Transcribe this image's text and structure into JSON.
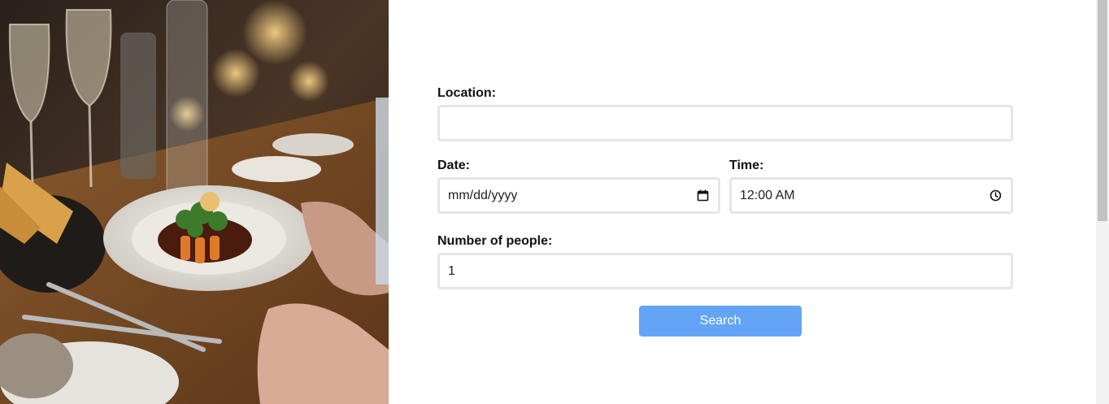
{
  "hero_image": {
    "description_icon": "restaurant-photo"
  },
  "form": {
    "location": {
      "label": "Location:",
      "value": ""
    },
    "date": {
      "label": "Date:",
      "value": "mm/dd/yyyy",
      "icon": "calendar-icon"
    },
    "time": {
      "label": "Time:",
      "value": "12:00 AM",
      "icon": "clock-icon"
    },
    "people": {
      "label": "Number of people:",
      "value": "1"
    },
    "search_label": "Search"
  },
  "colors": {
    "button": "#64a4f7",
    "input_border": "#e6e6e6",
    "scrollbar_track": "#f1f1f1",
    "scrollbar_thumb": "#c1c1c1"
  }
}
